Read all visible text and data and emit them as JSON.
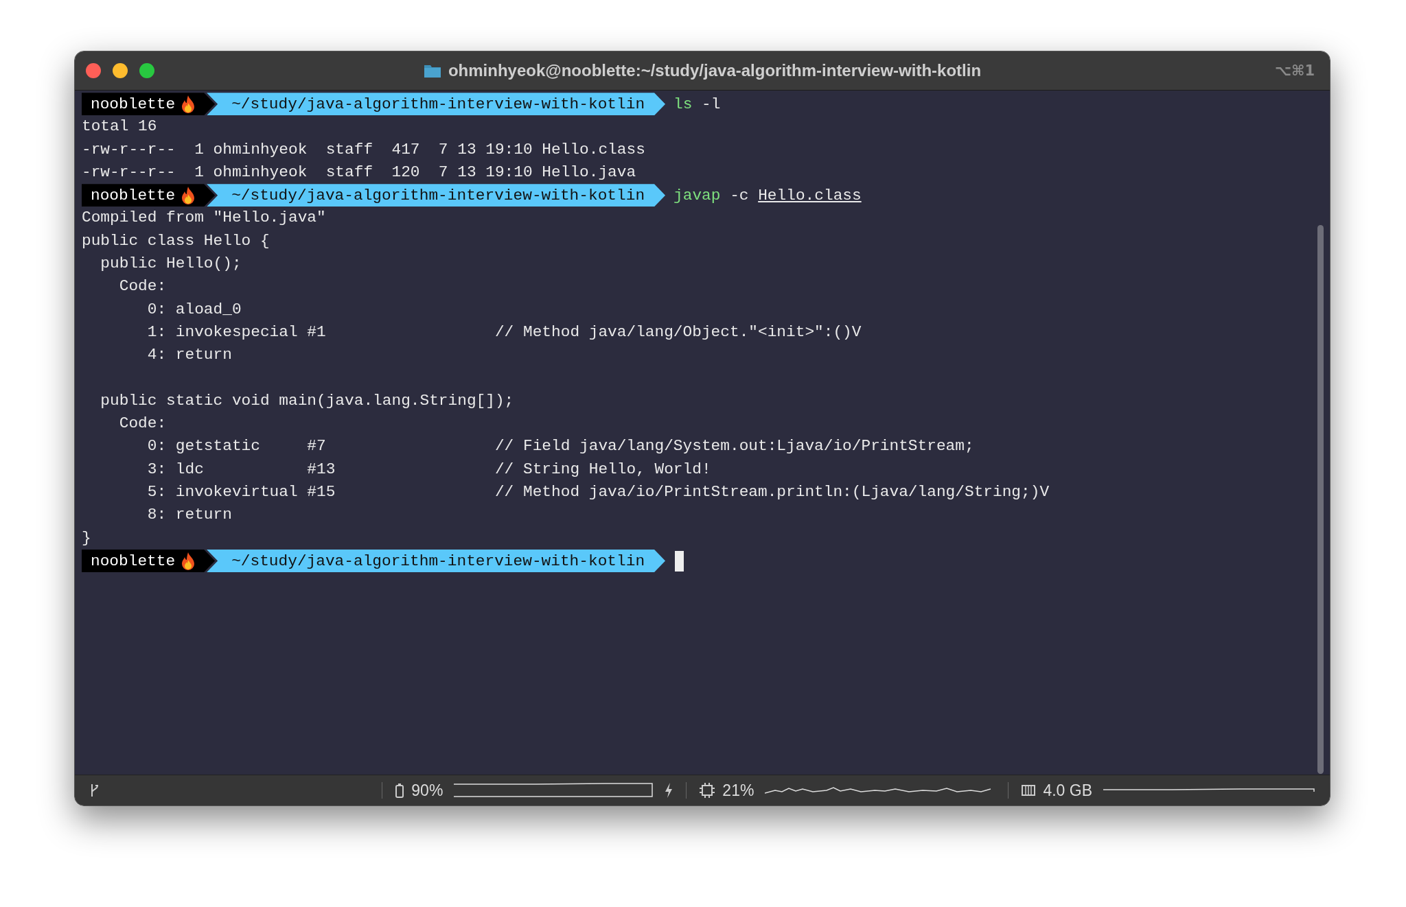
{
  "window": {
    "title": "ohminhyeok@nooblette:~/study/java-algorithm-interview-with-kotlin",
    "shortcut": "⌥⌘1"
  },
  "terminal": {
    "lines": [
      {
        "kind": "prompt",
        "host": "nooblette",
        "path": "~/study/java-algorithm-interview-with-kotlin",
        "command": [
          {
            "kind": "program",
            "text": "ls"
          },
          {
            "kind": "arg",
            "text": "-l"
          }
        ],
        "cursor": false
      },
      {
        "kind": "output",
        "text": "total 16"
      },
      {
        "kind": "output",
        "text": "-rw-r--r--  1 ohminhyeok  staff  417  7 13 19:10 Hello.class"
      },
      {
        "kind": "output",
        "text": "-rw-r--r--  1 ohminhyeok  staff  120  7 13 19:10 Hello.java"
      },
      {
        "kind": "prompt",
        "host": "nooblette",
        "path": "~/study/java-algorithm-interview-with-kotlin",
        "command": [
          {
            "kind": "program",
            "text": "javap"
          },
          {
            "kind": "arg",
            "text": "-c"
          },
          {
            "kind": "file",
            "text": "Hello.class"
          }
        ],
        "cursor": false
      },
      {
        "kind": "output",
        "text": "Compiled from \"Hello.java\""
      },
      {
        "kind": "output",
        "text": "public class Hello {"
      },
      {
        "kind": "output",
        "text": "  public Hello();"
      },
      {
        "kind": "output",
        "text": "    Code:"
      },
      {
        "kind": "output",
        "text": "       0: aload_0"
      },
      {
        "kind": "output",
        "text": "       1: invokespecial #1                  // Method java/lang/Object.\"<init>\":()V"
      },
      {
        "kind": "output",
        "text": "       4: return"
      },
      {
        "kind": "blank"
      },
      {
        "kind": "output",
        "text": "  public static void main(java.lang.String[]);"
      },
      {
        "kind": "output",
        "text": "    Code:"
      },
      {
        "kind": "output",
        "text": "       0: getstatic     #7                  // Field java/lang/System.out:Ljava/io/PrintStream;"
      },
      {
        "kind": "output",
        "text": "       3: ldc           #13                 // String Hello, World!"
      },
      {
        "kind": "output",
        "text": "       5: invokevirtual #15                 // Method java/io/PrintStream.println:(Ljava/lang/String;)V"
      },
      {
        "kind": "output",
        "text": "       8: return"
      },
      {
        "kind": "output",
        "text": "}"
      },
      {
        "kind": "prompt",
        "host": "nooblette",
        "path": "~/study/java-algorithm-interview-with-kotlin",
        "cursor": true
      }
    ]
  },
  "status_bar": {
    "battery": "90%",
    "cpu": "21%",
    "memory": "4.0 GB"
  }
}
